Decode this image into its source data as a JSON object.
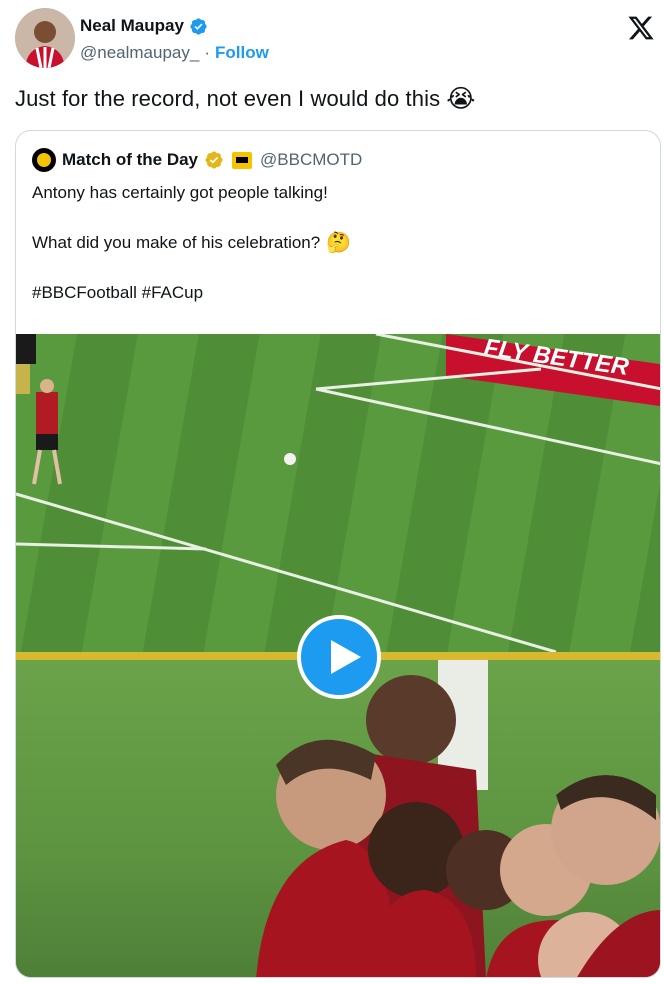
{
  "author": {
    "display_name": "Neal Maupay",
    "handle": "@nealmaupay_",
    "separator": "·",
    "follow_label": "Follow",
    "verified": true,
    "verified_color": "#1d9bf0"
  },
  "tweet": {
    "text": "Just for the record, not even I would do this",
    "emoji": "😭"
  },
  "quoted_tweet": {
    "display_name": "Match of the Day",
    "handle": "@BBCMOTD",
    "badge_color": "#e2b719",
    "lines": [
      {
        "text": "Antony has certainly got people talking!",
        "emoji": ""
      },
      {
        "text": "What did you make of his celebration?",
        "emoji": "🤔"
      },
      {
        "text": "#BBCFootball #FACup",
        "emoji": ""
      }
    ],
    "media": {
      "type": "video",
      "banner_text": "FLY BETTER",
      "play_button_color": "#1d9bf0"
    }
  },
  "icons": {
    "platform_logo": "x-logo-icon",
    "play": "play-icon"
  }
}
